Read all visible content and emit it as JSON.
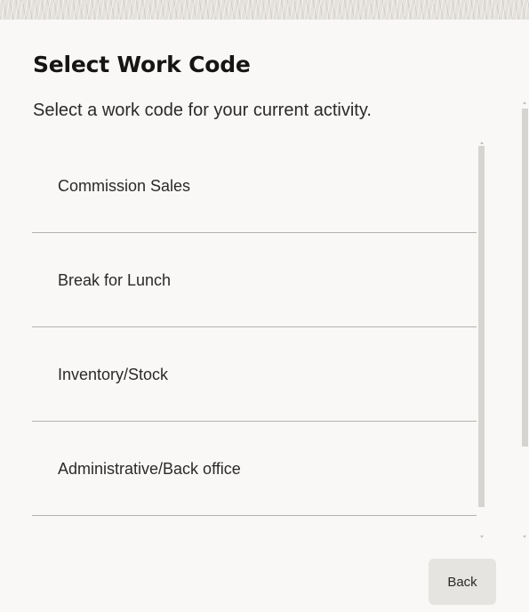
{
  "dialog": {
    "title": "Select Work Code",
    "subtitle": "Select a work code for your current activity.",
    "items": [
      {
        "label": "Commission Sales"
      },
      {
        "label": "Break for Lunch"
      },
      {
        "label": "Inventory/Stock"
      },
      {
        "label": "Administrative/Back office"
      }
    ],
    "back_label": "Back"
  },
  "colors": {
    "background": "#f9f8f6",
    "text": "#161513",
    "divider": "#b5b2ad",
    "button_bg": "#e6e4e1",
    "scrollbar": "#d6d4d1"
  }
}
